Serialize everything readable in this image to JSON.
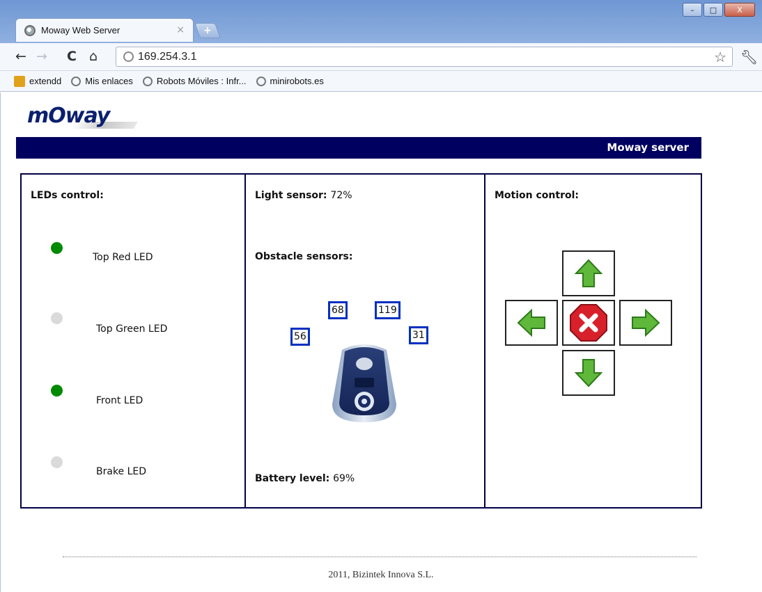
{
  "browser": {
    "tab_title": "Moway Web Server",
    "tab_close": "×",
    "new_tab": "+",
    "url": "169.254.3.1",
    "bookmarks": [
      {
        "label": "extendd",
        "icon": "extension-icon"
      },
      {
        "label": "Mis enlaces",
        "icon": "globe-icon"
      },
      {
        "label": "Robots Móviles : Infr...",
        "icon": "globe-icon"
      },
      {
        "label": "minirobots.es",
        "icon": "globe-icon"
      }
    ],
    "window_controls": {
      "minimize": "–",
      "maximize": "□",
      "close": "X"
    }
  },
  "header": {
    "logo_text": "mOway",
    "banner": "Moway server"
  },
  "leds": {
    "heading": "LEDs control:",
    "items": [
      {
        "label": "Top Red LED",
        "state": "on",
        "color": "#008a00"
      },
      {
        "label": "Top Green LED",
        "state": "off",
        "color": "#dadada"
      },
      {
        "label": "Front LED",
        "state": "on",
        "color": "#008a00"
      },
      {
        "label": "Brake LED",
        "state": "off",
        "color": "#dadada"
      }
    ]
  },
  "sensors": {
    "light_label": "Light sensor:",
    "light_value": "72%",
    "obstacle_heading": "Obstacle sensors:",
    "obstacle_values": {
      "left_side": "56",
      "left_center": "68",
      "right_center": "119",
      "right_side": "31"
    },
    "battery_label": "Battery level:",
    "battery_value": "69%"
  },
  "motion": {
    "heading": "Motion control:",
    "buttons": [
      "arrow-up-icon",
      "arrow-left-icon",
      "stop-icon",
      "arrow-right-icon",
      "arrow-down-icon"
    ]
  },
  "footer": {
    "text": "2011, Bizintek Innova S.L."
  }
}
